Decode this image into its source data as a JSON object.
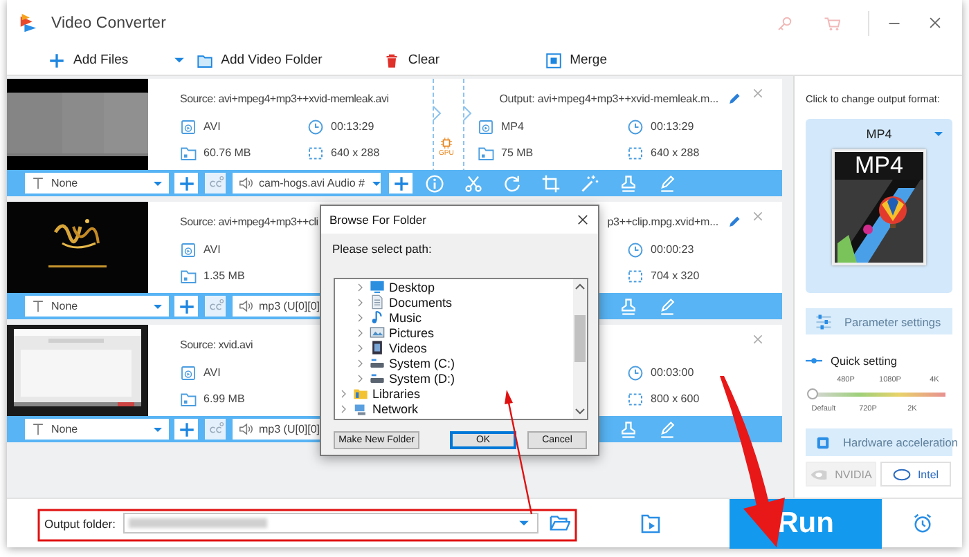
{
  "window": {
    "title": "Video Converter"
  },
  "toolbar": [
    {
      "label": "Add Files",
      "kind": "add"
    },
    {
      "label": "Add Video Folder",
      "kind": "folder"
    },
    {
      "label": "Clear",
      "kind": "clear"
    },
    {
      "label": "Merge",
      "kind": "merge"
    }
  ],
  "files": [
    {
      "source": {
        "name": "Source: avi+mpeg4+mp3++xvid-memleak.avi",
        "format": "AVI",
        "duration": "00:13:29",
        "size": "60.76 MB",
        "resolution": "640 x 288"
      },
      "gpu": "GPU",
      "output": {
        "name": "Output: avi+mpeg4+mp3++xvid-memleak.m...",
        "format": "MP4",
        "duration": "00:13:29",
        "size": "75 MB",
        "resolution": "640 x 288"
      },
      "rename": true,
      "subtitle": "None",
      "audio": "cam-hogs.avi Audio #",
      "tools": [
        {
          "kind": "add-audio"
        },
        {
          "kind": "info"
        },
        {
          "kind": "cut"
        },
        {
          "kind": "rotate"
        },
        {
          "kind": "crop"
        },
        {
          "kind": "effects"
        },
        {
          "kind": "watermark"
        },
        {
          "kind": "edit"
        }
      ]
    },
    {
      "source": {
        "name": "Source: avi+mpeg4+mp3++cli",
        "format": "AVI",
        "size": "1.35 MB"
      },
      "output": {
        "name": "p3++clip.mpg.xvid+m...",
        "duration": "00:00:23",
        "resolution": "704 x 320"
      },
      "rename": true,
      "subtitle": "None",
      "audio": "mp3 (U[0][0]",
      "tools": [
        {
          "kind": "watermark"
        },
        {
          "kind": "edit"
        }
      ]
    },
    {
      "source": {
        "name": "Source: xvid.avi",
        "format": "AVI",
        "size": "6.99 MB"
      },
      "output": {
        "duration": "00:03:00",
        "resolution": "800 x 600"
      },
      "rename": false,
      "subtitle": "None",
      "audio": "mp3 (U[0][0]",
      "tools": [
        {
          "kind": "watermark"
        },
        {
          "kind": "edit"
        }
      ]
    }
  ],
  "side": {
    "hint": "Click to change output format:",
    "format": {
      "label": "MP4",
      "badge": "MP4"
    },
    "parameter_button": "Parameter settings",
    "quick": {
      "label": "Quick setting",
      "top": [
        "480P",
        "1080P",
        "4K"
      ],
      "bottom": [
        "Default",
        "720P",
        "2K"
      ],
      "level": 0
    },
    "hardware": {
      "label": "Hardware acceleration",
      "options": [
        {
          "label": "NVIDIA",
          "kind": "nvidia",
          "disabled": true
        },
        {
          "label": "Intel",
          "kind": "intel",
          "disabled": false
        }
      ]
    }
  },
  "bottom": {
    "output_label": "Output folder:",
    "run": "Run"
  },
  "dialog": {
    "title": "Browse For Folder",
    "prompt": "Please select path:",
    "tree": [
      {
        "children": [
          {
            "label": "Desktop",
            "kind": "desktop",
            "expanded": false
          },
          {
            "label": "Documents",
            "kind": "documents",
            "expanded": false
          },
          {
            "label": "Music",
            "kind": "music",
            "expanded": false
          },
          {
            "label": "Pictures",
            "kind": "pictures",
            "expanded": false
          },
          {
            "label": "Videos",
            "kind": "videos",
            "expanded": false
          },
          {
            "label": "System (C:)",
            "kind": "drive",
            "expanded": false
          },
          {
            "label": "System (D:)",
            "kind": "drive",
            "expanded": false
          }
        ]
      },
      {
        "label": "Libraries",
        "kind": "libraries",
        "expanded": false
      },
      {
        "label": "Network",
        "kind": "network",
        "expanded": false
      }
    ],
    "buttons": [
      {
        "label": "Make New Folder",
        "default": false
      },
      {
        "label": "OK",
        "default": true
      },
      {
        "label": "Cancel",
        "default": false
      }
    ]
  },
  "annotations": [
    {
      "kind": "box"
    },
    {
      "kind": "arrow"
    },
    {
      "kind": "curved-arrow"
    }
  ]
}
